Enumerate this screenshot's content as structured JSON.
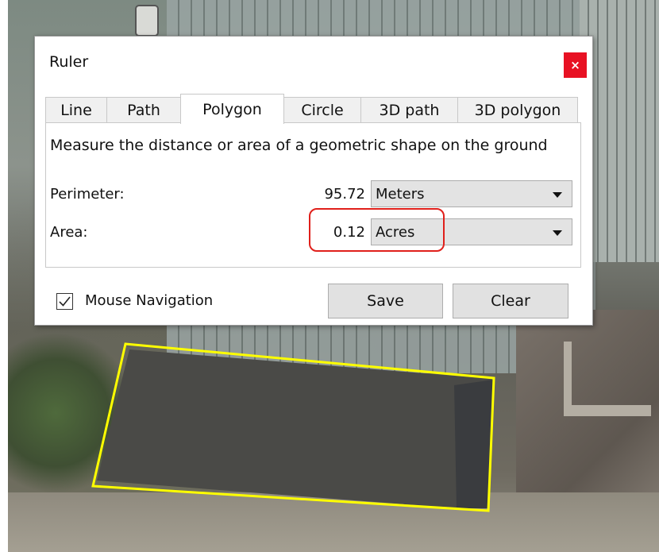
{
  "window": {
    "title": "Ruler",
    "close_label": "×"
  },
  "tabs": [
    {
      "label": "Line"
    },
    {
      "label": "Path"
    },
    {
      "label": "Polygon",
      "active": true
    },
    {
      "label": "Circle"
    },
    {
      "label": "3D path"
    },
    {
      "label": "3D polygon"
    }
  ],
  "description": "Measure the distance or area of a geometric shape on the ground",
  "perimeter": {
    "label": "Perimeter:",
    "value": "95.72",
    "unit": "Meters"
  },
  "area": {
    "label": "Area:",
    "value": "0.12",
    "unit": "Acres"
  },
  "mouse_navigation": {
    "label": "Mouse Navigation",
    "checked": true
  },
  "buttons": {
    "save": "Save",
    "clear": "Clear"
  },
  "colors": {
    "close_button": "#e81123",
    "highlight": "#e0201b",
    "polygon_outline": "#ffff00"
  },
  "icons": {
    "close": "close-icon",
    "dropdown": "chevron-down-icon",
    "check": "checkmark-icon"
  }
}
